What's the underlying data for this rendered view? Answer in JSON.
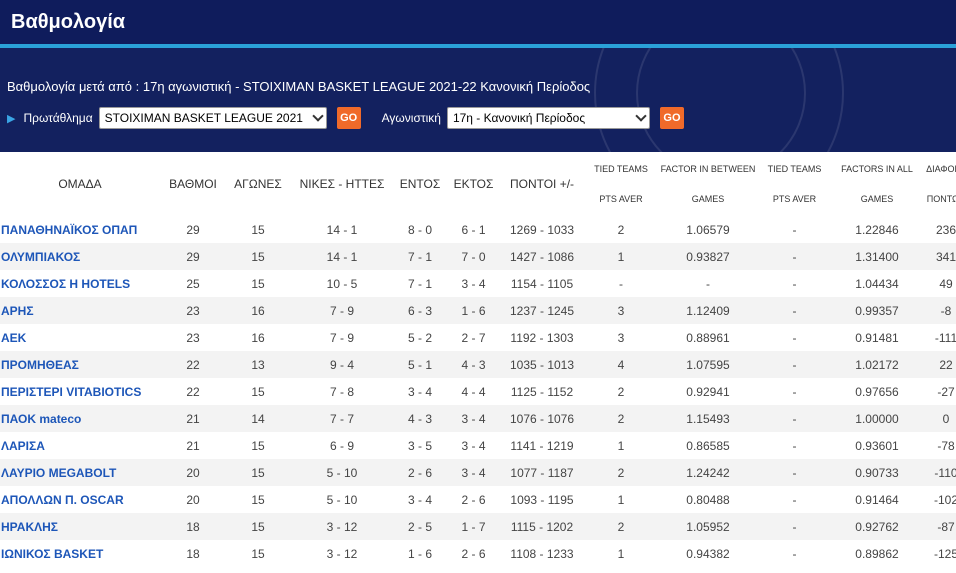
{
  "page_title": "Βαθμολογία",
  "subtitle": "Βαθμολογία μετά από : 17η αγωνιστική - STOIXIMAN BASKET LEAGUE 2021-22 Κανονική Περίοδος",
  "filters": {
    "championship_label": "Πρωτάθλημα",
    "championship_value": "STOIXIMAN BASKET LEAGUE 2021",
    "round_label": "Αγωνιστική",
    "round_value": "17η - Κανονική Περίοδος",
    "go_label": "GO"
  },
  "colors": {
    "header_bg": "#0f1c5c",
    "accent": "#2aa1d8",
    "go_button": "#f06a2a",
    "team_link": "#1d56b8"
  },
  "table": {
    "headers": {
      "team": "ΟΜΑΔΑ",
      "points": "ΒΑΘΜΟΙ",
      "games": "ΑΓΩΝΕΣ",
      "wins_losses": "ΝΙΚΕΣ - ΗΤΤΕΣ",
      "home": "ΕΝΤΟΣ",
      "away": "ΕΚΤΟΣ",
      "score": "ΠΟΝΤΟΙ +/-",
      "tied_teams_1": "TIED TEAMS",
      "pts_aver_1": "PTS AVER",
      "factor_between_1": "FACTOR IN BETWEEN",
      "factor_between_2": "GAMES",
      "tied_teams_2": "TIED TEAMS",
      "pts_aver_2": "PTS AVER",
      "factors_all_1": "FACTORS IN ALL",
      "factors_all_2": "GAMES",
      "diff_1": "ΔΙΑΦΟΡΑ",
      "diff_2": "ΠΟΝΤΩΝ"
    },
    "rows": [
      [
        "ΠΑΝΑΘΗΝΑΪΚΟΣ ΟΠΑΠ",
        "29",
        "15",
        "14 - 1",
        "8 - 0",
        "6 - 1",
        "1269 - 1033",
        "2",
        "1.06579",
        "-",
        "1.22846",
        "236"
      ],
      [
        "ΟΛΥΜΠΙΑΚΟΣ",
        "29",
        "15",
        "14 - 1",
        "7 - 1",
        "7 - 0",
        "1427 - 1086",
        "1",
        "0.93827",
        "-",
        "1.31400",
        "341"
      ],
      [
        "ΚΟΛΟΣΣΟΣ Η HOTELS",
        "25",
        "15",
        "10 - 5",
        "7 - 1",
        "3 - 4",
        "1154 - 1105",
        "-",
        "-",
        "-",
        "1.04434",
        "49"
      ],
      [
        "ΑΡΗΣ",
        "23",
        "16",
        "7 - 9",
        "6 - 3",
        "1 - 6",
        "1237 - 1245",
        "3",
        "1.12409",
        "-",
        "0.99357",
        "-8"
      ],
      [
        "ΑΕΚ",
        "23",
        "16",
        "7 - 9",
        "5 - 2",
        "2 - 7",
        "1192 - 1303",
        "3",
        "0.88961",
        "-",
        "0.91481",
        "-111"
      ],
      [
        "ΠΡΟΜΗΘΕΑΣ",
        "22",
        "13",
        "9 - 4",
        "5 - 1",
        "4 - 3",
        "1035 - 1013",
        "4",
        "1.07595",
        "-",
        "1.02172",
        "22"
      ],
      [
        "ΠΕΡΙΣΤΕΡΙ VITABIOTICS",
        "22",
        "15",
        "7 - 8",
        "3 - 4",
        "4 - 4",
        "1125 - 1152",
        "2",
        "0.92941",
        "-",
        "0.97656",
        "-27"
      ],
      [
        "ΠΑΟΚ mateco",
        "21",
        "14",
        "7 - 7",
        "4 - 3",
        "3 - 4",
        "1076 - 1076",
        "2",
        "1.15493",
        "-",
        "1.00000",
        "0"
      ],
      [
        "ΛΑΡΙΣΑ",
        "21",
        "15",
        "6 - 9",
        "3 - 5",
        "3 - 4",
        "1141 - 1219",
        "1",
        "0.86585",
        "-",
        "0.93601",
        "-78"
      ],
      [
        "ΛΑΥΡΙΟ MEGABOLT",
        "20",
        "15",
        "5 - 10",
        "2 - 6",
        "3 - 4",
        "1077 - 1187",
        "2",
        "1.24242",
        "-",
        "0.90733",
        "-110"
      ],
      [
        "ΑΠΟΛΛΩΝ Π. OSCAR",
        "20",
        "15",
        "5 - 10",
        "3 - 4",
        "2 - 6",
        "1093 - 1195",
        "1",
        "0.80488",
        "-",
        "0.91464",
        "-102"
      ],
      [
        "ΗΡΑΚΛΗΣ",
        "18",
        "15",
        "3 - 12",
        "2 - 5",
        "1 - 7",
        "1115 - 1202",
        "2",
        "1.05952",
        "-",
        "0.92762",
        "-87"
      ],
      [
        "ΙΩΝΙΚΟΣ BASKET",
        "18",
        "15",
        "3 - 12",
        "1 - 6",
        "2 - 6",
        "1108 - 1233",
        "1",
        "0.94382",
        "-",
        "0.89862",
        "-125"
      ]
    ]
  }
}
